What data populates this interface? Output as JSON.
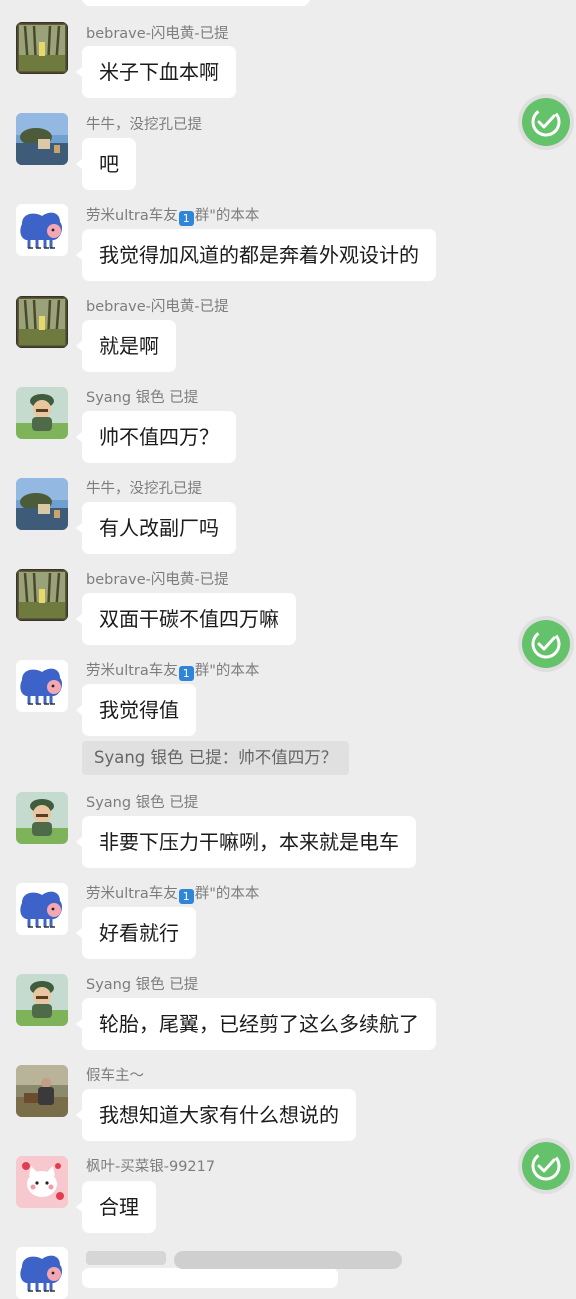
{
  "colors": {
    "background": "#ededed",
    "bubble": "#ffffff",
    "sender": "#7d7d7d",
    "check_green": "#63c26a",
    "quote_bg": "#e0e0e0"
  },
  "messages": [
    {
      "sender": "bebrave-闪电黄-已提",
      "text": "米子下血本啊",
      "avatar": "forest-avatar"
    },
    {
      "sender": "牛牛，没挖孔已提",
      "text": "吧",
      "avatar": "lake-avatar"
    },
    {
      "sender_prefix": "劳米ultra车友",
      "sender_badge": "1",
      "sender_suffix": "群\"的本本",
      "text": "我觉得加风道的都是奔着外观设计的",
      "avatar": "blue-cat-avatar"
    },
    {
      "sender": "bebrave-闪电黄-已提",
      "text": "就是啊",
      "avatar": "forest-avatar"
    },
    {
      "sender": "Syang  银色 已提",
      "text": "帅不值四万？",
      "avatar": "mario-avatar"
    },
    {
      "sender": "牛牛，没挖孔已提",
      "text": "有人改副厂吗",
      "avatar": "lake-avatar"
    },
    {
      "sender": "bebrave-闪电黄-已提",
      "text": "双面干碳不值四万嘛",
      "avatar": "forest-avatar"
    },
    {
      "sender_prefix": "劳米ultra车友",
      "sender_badge": "1",
      "sender_suffix": "群\"的本本",
      "text": "我觉得值",
      "avatar": "blue-cat-avatar",
      "quote": "Syang  银色 已提：帅不值四万？"
    },
    {
      "sender": "Syang  银色 已提",
      "text": "非要下压力干嘛咧，本来就是电车",
      "avatar": "mario-avatar"
    },
    {
      "sender_prefix": "劳米ultra车友",
      "sender_badge": "1",
      "sender_suffix": "群\"的本本",
      "text": "好看就行",
      "avatar": "blue-cat-avatar"
    },
    {
      "sender": "Syang  银色 已提",
      "text": "轮胎，尾翼，已经剪了这么多续航了",
      "avatar": "mario-avatar"
    },
    {
      "sender": "假车主～",
      "text": "我想知道大家有什么想说的",
      "avatar": "person-avatar"
    },
    {
      "sender": "枫叶-买菜银-99217",
      "text": "合理",
      "avatar": "pink-cat-avatar"
    }
  ]
}
